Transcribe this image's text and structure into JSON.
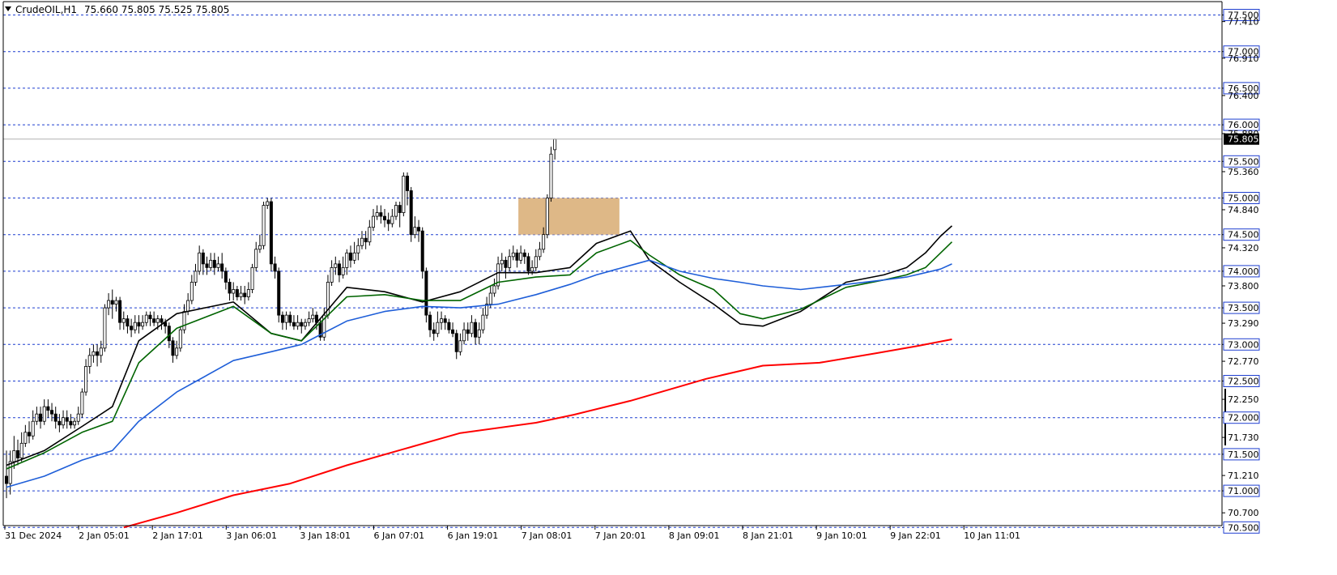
{
  "header": {
    "symbol": "CrudeOIL,H1",
    "ohlc": "75.660 75.805 75.525 75.805",
    "menu_icon": "triangle-down-icon"
  },
  "colors": {
    "background": "#ffffff",
    "grid": "#1f3fd0",
    "candle_outline": "#000000",
    "candle_bull_fill": "#ffffff",
    "candle_bear_fill": "#000000",
    "ma_fast": "#000000",
    "ma_mid": "#006400",
    "ma_slow": "#1e5ed8",
    "ma_long": "#ff0000",
    "zone": "#deb887",
    "price_tag_bg": "#000000",
    "price_tag_fg": "#ffffff"
  },
  "chart_data": {
    "type": "candlestick",
    "title": "CrudeOIL,H1",
    "current_price": "75.805",
    "ylim": [
      70.5,
      77.6
    ],
    "grid": "horizontal dashed at labeled levels",
    "level_lines": [
      "77.500",
      "77.000",
      "76.500",
      "76.000",
      "75.500",
      "75.000",
      "74.500",
      "74.000",
      "73.500",
      "73.000",
      "72.500",
      "72.000",
      "71.500",
      "71.000",
      "70.500"
    ],
    "y_ticks": [
      "77.500",
      "77.410",
      "77.000",
      "76.910",
      "76.500",
      "76.400",
      "76.000",
      "75.880",
      "75.500",
      "75.360",
      "75.000",
      "74.840",
      "74.500",
      "74.320",
      "74.000",
      "73.800",
      "73.500",
      "73.290",
      "73.000",
      "72.770",
      "72.500",
      "72.250",
      "72.000",
      "71.730",
      "71.500",
      "71.210",
      "71.000",
      "70.700",
      "70.500"
    ],
    "x_ticks": [
      "31 Dec 2024",
      "2 Jan 05:01",
      "2 Jan 17:01",
      "3 Jan 06:01",
      "3 Jan 18:01",
      "6 Jan 07:01",
      "6 Jan 19:01",
      "7 Jan 08:01",
      "7 Jan 20:01",
      "8 Jan 09:01",
      "8 Jan 21:01",
      "9 Jan 10:01",
      "9 Jan 22:01",
      "10 Jan 11:01"
    ],
    "zone": {
      "from_price": 74.5,
      "to_price": 75.0,
      "start_bar": 136,
      "end_bar": 161
    },
    "series": [
      {
        "role": "ma_fast",
        "keypoints": [
          [
            0,
            71.35
          ],
          [
            10,
            71.55
          ],
          [
            20,
            71.88
          ],
          [
            28,
            72.15
          ],
          [
            35,
            73.05
          ],
          [
            45,
            73.42
          ],
          [
            60,
            73.58
          ],
          [
            70,
            73.15
          ],
          [
            78,
            73.05
          ],
          [
            90,
            73.78
          ],
          [
            100,
            73.72
          ],
          [
            110,
            73.58
          ],
          [
            120,
            73.72
          ],
          [
            130,
            73.98
          ],
          [
            140,
            73.98
          ],
          [
            149,
            74.05
          ],
          [
            156,
            74.38
          ],
          [
            165,
            74.55
          ],
          [
            170,
            74.15
          ],
          [
            178,
            73.85
          ],
          [
            187,
            73.55
          ],
          [
            194,
            73.28
          ],
          [
            200,
            73.25
          ],
          [
            210,
            73.45
          ],
          [
            222,
            73.85
          ],
          [
            232,
            73.95
          ],
          [
            238,
            74.05
          ],
          [
            243,
            74.25
          ],
          [
            247,
            74.48
          ],
          [
            250,
            74.62
          ]
        ]
      },
      {
        "role": "ma_mid",
        "keypoints": [
          [
            0,
            71.3
          ],
          [
            10,
            71.52
          ],
          [
            20,
            71.8
          ],
          [
            28,
            71.95
          ],
          [
            35,
            72.75
          ],
          [
            45,
            73.22
          ],
          [
            60,
            73.52
          ],
          [
            70,
            73.15
          ],
          [
            78,
            73.05
          ],
          [
            90,
            73.65
          ],
          [
            100,
            73.68
          ],
          [
            110,
            73.6
          ],
          [
            120,
            73.6
          ],
          [
            130,
            73.85
          ],
          [
            140,
            73.92
          ],
          [
            149,
            73.95
          ],
          [
            156,
            74.25
          ],
          [
            165,
            74.42
          ],
          [
            170,
            74.22
          ],
          [
            178,
            73.95
          ],
          [
            187,
            73.75
          ],
          [
            194,
            73.42
          ],
          [
            200,
            73.35
          ],
          [
            210,
            73.48
          ],
          [
            222,
            73.78
          ],
          [
            232,
            73.88
          ],
          [
            238,
            73.95
          ],
          [
            243,
            74.05
          ],
          [
            247,
            74.25
          ],
          [
            250,
            74.4
          ]
        ]
      },
      {
        "role": "ma_slow",
        "keypoints": [
          [
            0,
            71.05
          ],
          [
            10,
            71.2
          ],
          [
            20,
            71.42
          ],
          [
            28,
            71.55
          ],
          [
            35,
            71.95
          ],
          [
            45,
            72.35
          ],
          [
            60,
            72.78
          ],
          [
            70,
            72.9
          ],
          [
            78,
            73.0
          ],
          [
            90,
            73.32
          ],
          [
            100,
            73.45
          ],
          [
            110,
            73.52
          ],
          [
            120,
            73.5
          ],
          [
            130,
            73.55
          ],
          [
            140,
            73.68
          ],
          [
            149,
            73.82
          ],
          [
            156,
            73.95
          ],
          [
            165,
            74.08
          ],
          [
            170,
            74.15
          ],
          [
            178,
            74.0
          ],
          [
            187,
            73.9
          ],
          [
            194,
            73.85
          ],
          [
            200,
            73.8
          ],
          [
            210,
            73.75
          ],
          [
            222,
            73.82
          ],
          [
            232,
            73.88
          ],
          [
            238,
            73.92
          ],
          [
            243,
            73.98
          ],
          [
            247,
            74.03
          ],
          [
            250,
            74.1
          ]
        ]
      },
      {
        "role": "ma_long",
        "keypoints": [
          [
            31,
            70.5
          ],
          [
            45,
            70.7
          ],
          [
            60,
            70.94
          ],
          [
            75,
            71.1
          ],
          [
            90,
            71.35
          ],
          [
            105,
            71.57
          ],
          [
            120,
            71.79
          ],
          [
            140,
            71.93
          ],
          [
            150,
            72.04
          ],
          [
            165,
            72.23
          ],
          [
            185,
            72.53
          ],
          [
            200,
            72.71
          ],
          [
            215,
            72.75
          ],
          [
            230,
            72.88
          ],
          [
            241,
            72.98
          ],
          [
            250,
            73.07
          ]
        ]
      }
    ],
    "candles_approx": [
      [
        71.2,
        71.1,
        71.55,
        70.9
      ],
      [
        71.1,
        71.4,
        71.55,
        70.95
      ],
      [
        71.4,
        71.55,
        71.75,
        71.3
      ],
      [
        71.55,
        71.45,
        71.7,
        71.35
      ],
      [
        71.45,
        71.65,
        71.8,
        71.4
      ],
      [
        71.65,
        71.8,
        71.9,
        71.6
      ],
      [
        71.8,
        71.75,
        71.95,
        71.65
      ],
      [
        71.75,
        71.95,
        72.1,
        71.7
      ],
      [
        71.95,
        72.05,
        72.15,
        71.9
      ],
      [
        72.05,
        71.95,
        72.15,
        71.85
      ],
      [
        71.95,
        72.15,
        72.25,
        71.9
      ],
      [
        72.15,
        72.1,
        72.25,
        72.0
      ],
      [
        72.1,
        72.05,
        72.2,
        71.95
      ],
      [
        72.05,
        71.95,
        72.15,
        71.85
      ],
      [
        71.95,
        71.9,
        72.05,
        71.8
      ],
      [
        71.9,
        72.0,
        72.1,
        71.85
      ],
      [
        72.0,
        71.95,
        72.1,
        71.85
      ],
      [
        71.95,
        71.9,
        72.05,
        71.85
      ],
      [
        71.9,
        71.95,
        72.0,
        71.85
      ],
      [
        71.95,
        72.05,
        72.15,
        71.9
      ],
      [
        72.05,
        72.35,
        72.4,
        72.0
      ],
      [
        72.35,
        72.7,
        72.8,
        72.3
      ],
      [
        72.7,
        72.85,
        72.95,
        72.6
      ],
      [
        72.85,
        72.9,
        73.0,
        72.75
      ],
      [
        72.9,
        72.85,
        73.0,
        72.7
      ],
      [
        72.85,
        72.95,
        73.05,
        72.75
      ],
      [
        72.95,
        73.5,
        73.55,
        72.9
      ],
      [
        73.5,
        73.6,
        73.7,
        73.4
      ],
      [
        73.6,
        73.55,
        73.75,
        73.35
      ],
      [
        73.55,
        73.6,
        73.65,
        73.45
      ],
      [
        73.6,
        73.3,
        73.65,
        73.2
      ],
      [
        73.3,
        73.35,
        73.45,
        73.2
      ],
      [
        73.35,
        73.25,
        73.4,
        73.15
      ],
      [
        73.25,
        73.2,
        73.35,
        73.1
      ],
      [
        73.2,
        73.3,
        73.4,
        73.15
      ],
      [
        73.3,
        73.25,
        73.4,
        73.15
      ],
      [
        73.25,
        73.3,
        73.4,
        73.2
      ],
      [
        73.3,
        73.4,
        73.45,
        73.25
      ],
      [
        73.4,
        73.35,
        73.45,
        73.25
      ],
      [
        73.35,
        73.3,
        73.45,
        73.25
      ],
      [
        73.3,
        73.35,
        73.4,
        73.2
      ],
      [
        73.35,
        73.3,
        73.4,
        73.2
      ],
      [
        73.3,
        73.25,
        73.35,
        73.15
      ],
      [
        73.25,
        73.05,
        73.3,
        72.95
      ],
      [
        73.05,
        72.85,
        73.1,
        72.75
      ],
      [
        72.85,
        72.95,
        73.05,
        72.8
      ],
      [
        72.95,
        73.2,
        73.25,
        72.9
      ],
      [
        73.2,
        73.45,
        73.55,
        73.15
      ],
      [
        73.45,
        73.6,
        73.7,
        73.4
      ],
      [
        73.6,
        73.85,
        73.95,
        73.55
      ],
      [
        73.85,
        74.0,
        74.1,
        73.8
      ],
      [
        74.0,
        74.25,
        74.35,
        73.95
      ],
      [
        74.25,
        74.1,
        74.3,
        73.95
      ],
      [
        74.1,
        74.05,
        74.2,
        73.95
      ],
      [
        74.05,
        74.15,
        74.25,
        74.0
      ],
      [
        74.15,
        74.05,
        74.25,
        73.95
      ],
      [
        74.05,
        74.1,
        74.2,
        74.0
      ],
      [
        74.1,
        74.0,
        74.25,
        73.9
      ],
      [
        74.0,
        73.85,
        74.05,
        73.75
      ],
      [
        73.85,
        73.7,
        73.9,
        73.6
      ],
      [
        73.7,
        73.75,
        73.85,
        73.6
      ],
      [
        73.75,
        73.65,
        73.8,
        73.6
      ],
      [
        73.65,
        73.7,
        73.8,
        73.6
      ],
      [
        73.7,
        73.65,
        73.8,
        73.55
      ],
      [
        73.65,
        73.75,
        73.85,
        73.6
      ],
      [
        73.75,
        74.05,
        74.1,
        73.7
      ],
      [
        74.05,
        74.3,
        74.4,
        74.0
      ],
      [
        74.3,
        74.35,
        74.5,
        74.25
      ],
      [
        74.35,
        74.9,
        74.95,
        74.3
      ],
      [
        74.9,
        74.95,
        75.0,
        74.85
      ],
      [
        74.95,
        74.1,
        75.0,
        74.0
      ],
      [
        74.1,
        74.0,
        74.2,
        73.9
      ],
      [
        74.0,
        73.4,
        74.05,
        73.3
      ],
      [
        73.4,
        73.3,
        73.45,
        73.2
      ],
      [
        73.3,
        73.4,
        73.45,
        73.2
      ],
      [
        73.4,
        73.3,
        73.45,
        73.25
      ],
      [
        73.3,
        73.25,
        73.4,
        73.2
      ],
      [
        73.25,
        73.3,
        73.4,
        73.2
      ],
      [
        73.3,
        73.25,
        73.35,
        73.15
      ],
      [
        73.25,
        73.3,
        73.35,
        73.2
      ],
      [
        73.3,
        73.35,
        73.45,
        73.25
      ],
      [
        73.35,
        73.4,
        73.5,
        73.3
      ],
      [
        73.4,
        73.3,
        73.45,
        73.2
      ],
      [
        73.3,
        73.1,
        73.35,
        73.05
      ],
      [
        73.1,
        73.4,
        73.5,
        73.05
      ],
      [
        73.4,
        73.85,
        73.95,
        73.35
      ],
      [
        73.85,
        74.05,
        74.15,
        73.8
      ],
      [
        74.05,
        74.1,
        74.2,
        73.95
      ],
      [
        74.1,
        73.95,
        74.15,
        73.85
      ],
      [
        73.95,
        74.05,
        74.2,
        73.9
      ],
      [
        74.05,
        74.25,
        74.3,
        73.95
      ],
      [
        74.25,
        74.15,
        74.35,
        74.05
      ],
      [
        74.15,
        74.25,
        74.4,
        74.1
      ],
      [
        74.25,
        74.35,
        74.45,
        74.15
      ],
      [
        74.35,
        74.45,
        74.55,
        74.3
      ],
      [
        74.45,
        74.4,
        74.55,
        74.3
      ],
      [
        74.4,
        74.6,
        74.7,
        74.35
      ],
      [
        74.6,
        74.75,
        74.85,
        74.55
      ],
      [
        74.75,
        74.8,
        74.9,
        74.7
      ],
      [
        74.8,
        74.75,
        74.9,
        74.65
      ],
      [
        74.75,
        74.7,
        74.85,
        74.6
      ],
      [
        74.7,
        74.65,
        74.8,
        74.55
      ],
      [
        74.65,
        74.75,
        74.85,
        74.6
      ],
      [
        74.75,
        74.9,
        74.95,
        74.7
      ],
      [
        74.9,
        74.8,
        74.95,
        74.6
      ],
      [
        74.8,
        75.3,
        75.35,
        74.75
      ],
      [
        75.3,
        75.1,
        75.35,
        74.9
      ],
      [
        75.1,
        74.5,
        75.15,
        74.4
      ],
      [
        74.5,
        74.6,
        74.75,
        74.45
      ],
      [
        74.6,
        74.55,
        74.7,
        74.4
      ],
      [
        74.55,
        74.0,
        74.6,
        73.9
      ],
      [
        74.0,
        73.4,
        74.05,
        73.3
      ],
      [
        73.4,
        73.2,
        73.45,
        73.1
      ],
      [
        73.2,
        73.15,
        73.3,
        73.05
      ],
      [
        73.15,
        73.3,
        73.45,
        73.1
      ],
      [
        73.3,
        73.35,
        73.45,
        73.2
      ],
      [
        73.35,
        73.3,
        73.4,
        73.2
      ],
      [
        73.3,
        73.2,
        73.35,
        73.15
      ],
      [
        73.2,
        73.15,
        73.3,
        73.1
      ],
      [
        73.15,
        72.9,
        73.2,
        72.8
      ],
      [
        72.9,
        73.05,
        73.15,
        72.85
      ],
      [
        73.05,
        73.2,
        73.3,
        73.0
      ],
      [
        73.2,
        73.15,
        73.3,
        73.05
      ],
      [
        73.15,
        73.3,
        73.4,
        73.1
      ],
      [
        73.3,
        73.1,
        73.35,
        73.0
      ],
      [
        73.1,
        73.2,
        73.3,
        73.0
      ],
      [
        73.2,
        73.4,
        73.5,
        73.15
      ],
      [
        73.4,
        73.55,
        73.65,
        73.35
      ],
      [
        73.55,
        73.7,
        73.8,
        73.5
      ],
      [
        73.7,
        73.8,
        73.9,
        73.65
      ],
      [
        73.8,
        74.1,
        74.2,
        73.75
      ],
      [
        74.1,
        74.15,
        74.25,
        74.0
      ],
      [
        74.15,
        74.05,
        74.2,
        73.9
      ],
      [
        74.05,
        74.2,
        74.3,
        74.0
      ],
      [
        74.2,
        74.25,
        74.35,
        74.15
      ],
      [
        74.25,
        74.15,
        74.3,
        74.05
      ],
      [
        74.15,
        74.25,
        74.35,
        74.1
      ],
      [
        74.25,
        74.2,
        74.3,
        74.1
      ],
      [
        74.2,
        74.0,
        74.25,
        73.95
      ],
      [
        74.0,
        74.05,
        74.15,
        73.95
      ],
      [
        74.05,
        74.2,
        74.3,
        74.0
      ],
      [
        74.2,
        74.3,
        74.4,
        74.15
      ],
      [
        74.3,
        74.5,
        74.6,
        74.25
      ],
      [
        74.5,
        75.0,
        75.05,
        74.45
      ],
      [
        75.0,
        75.6,
        75.7,
        74.95
      ],
      [
        75.66,
        75.805,
        75.805,
        75.525
      ]
    ]
  }
}
